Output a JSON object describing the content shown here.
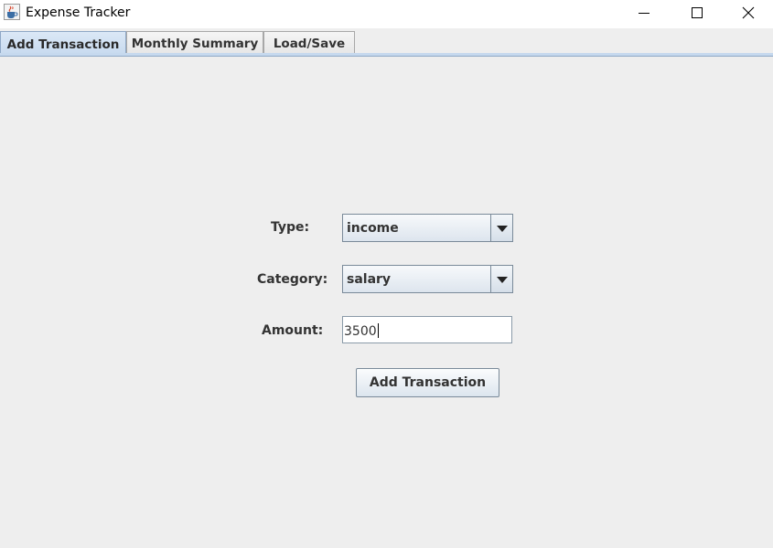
{
  "window": {
    "title": "Expense Tracker",
    "icon": "java-cup-icon",
    "controls": {
      "minimize_icon": "minimize-icon",
      "maximize_icon": "maximize-icon",
      "close_icon": "close-icon"
    }
  },
  "tabs": [
    {
      "label": "Add Transaction",
      "selected": true
    },
    {
      "label": "Monthly Summary",
      "selected": false
    },
    {
      "label": "Load/Save",
      "selected": false
    }
  ],
  "form": {
    "type": {
      "label": "Type:",
      "value": "income"
    },
    "category": {
      "label": "Category:",
      "value": "salary"
    },
    "amount": {
      "label": "Amount:",
      "value": "3500"
    },
    "submit_label": "Add Transaction"
  },
  "colors": {
    "selected_tab": "#c6d9ee",
    "panel_background": "#eeeeee"
  }
}
